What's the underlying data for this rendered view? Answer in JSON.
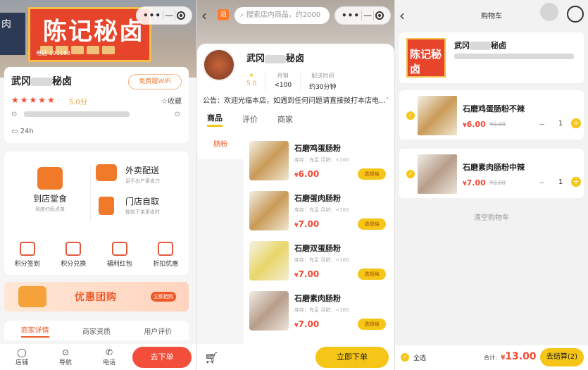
{
  "panel1": {
    "sign_text": "陈记秘卤",
    "sign_phone": "电话 191183",
    "shop_name": "武冈",
    "shop_name_suffix": "秘卤",
    "wifi_label": "免费蹭WiFi",
    "stars": "★★★★★",
    "rating": "5.0分",
    "collect_label": "收藏",
    "hours": "24h",
    "services": {
      "dinein_title": "到店堂食",
      "dinein_sub": "到座扫码点单",
      "delivery_title": "外卖配送",
      "delivery_sub": "足不出户更省力",
      "pickup_title": "门店自取",
      "pickup_sub": "提前下单更省时"
    },
    "mini_items": [
      "积分签到",
      "积分兑换",
      "福利红包",
      "折扣优惠"
    ],
    "promo_title": "优惠团购",
    "promo_button": "立即抢购",
    "tabs": [
      "商家详情",
      "商家资质",
      "用户评价"
    ],
    "bottom_nav": [
      "店铺",
      "导航",
      "电话"
    ],
    "order_button": "去下单"
  },
  "panel2": {
    "logo": "滔",
    "search_placeholder": "搜索店内商品，约2000",
    "shop_name": "武冈",
    "shop_name_suffix": "秘卤",
    "stats": [
      {
        "label": "★",
        "value": "5.0"
      },
      {
        "label": "月销",
        "value": "<100"
      },
      {
        "label": "配送时间",
        "value": "约30分钟"
      }
    ],
    "notice": "公告：欢迎光临本店，如遇到任何问题请直接拨打本店电...",
    "tabs": [
      "商品",
      "评价",
      "商家"
    ],
    "category": "肠粉",
    "products": [
      {
        "name": "石磨鸡蛋肠粉",
        "meta": "库存：充足   月销：<100",
        "price": "6.00",
        "spec": "选规格"
      },
      {
        "name": "石磨蛋肉肠粉",
        "meta": "库存：充足   月销：<100",
        "price": "7.00",
        "spec": "选规格"
      },
      {
        "name": "石磨双蛋肠粉",
        "meta": "库存：充足   月销：<100",
        "price": "7.00",
        "spec": "选规格"
      },
      {
        "name": "石磨素肉肠粉",
        "meta": "库存：充足   月销：<100",
        "price": "7.00",
        "spec": "选规格"
      }
    ],
    "buy_button": "立即下单"
  },
  "panel3": {
    "title": "购物车",
    "shop_name": "武冈",
    "shop_name_suffix": "秘卤",
    "shop_img_text": "陈记秘卤",
    "items": [
      {
        "name": "石磨鸡蛋肠粉不辣",
        "price": "6.00",
        "old": "¥0.00",
        "qty": "1"
      },
      {
        "name": "石磨素肉肠粉中辣",
        "price": "7.00",
        "old": "¥0.00",
        "qty": "1"
      }
    ],
    "clear_label": "清空购物车",
    "select_all": "全选",
    "total_label": "合计:",
    "total": "13.00",
    "checkout": "去结算(2)"
  },
  "colors": {
    "accent": "#f24a35",
    "yellow": "#f5c518",
    "orange": "#ef5a2a"
  }
}
